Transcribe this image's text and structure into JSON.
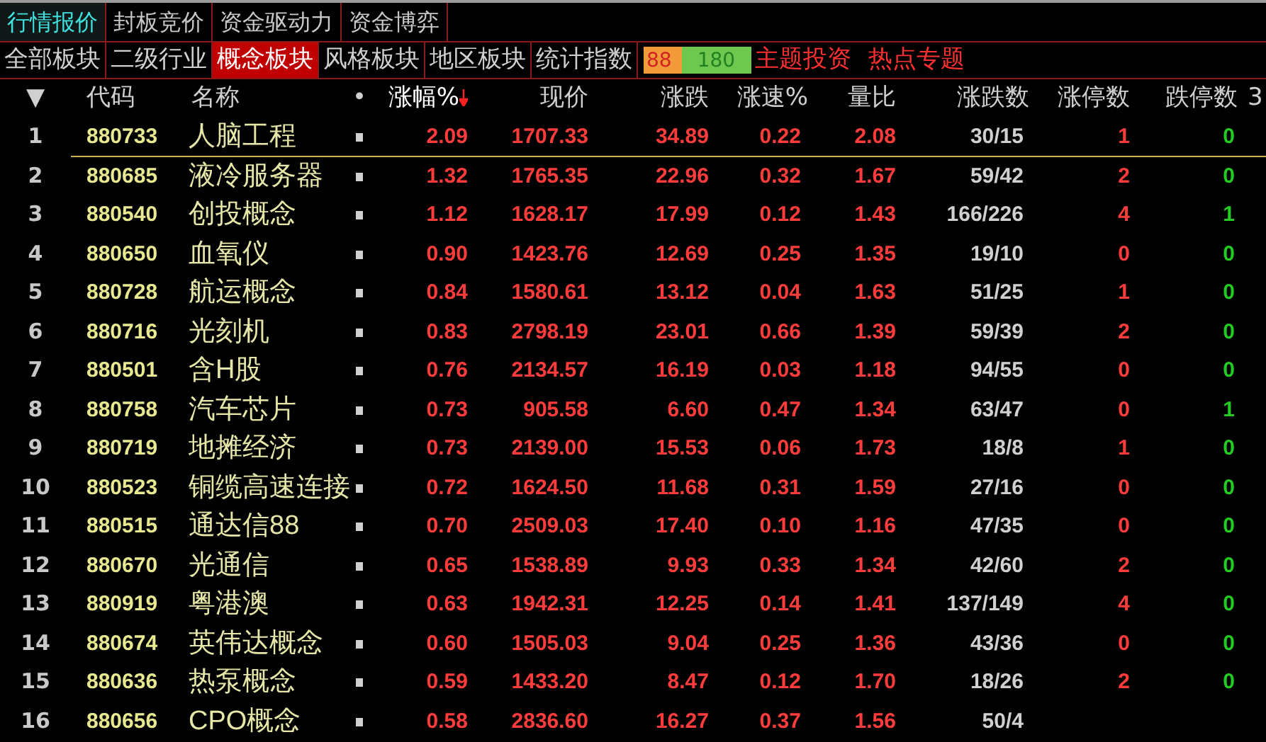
{
  "top_tabs": [
    {
      "label": "行情报价",
      "selected": true
    },
    {
      "label": "封板竞价",
      "selected": false
    },
    {
      "label": "资金驱动力",
      "selected": false
    },
    {
      "label": "资金博弈",
      "selected": false
    }
  ],
  "board_tabs": [
    {
      "label": "全部板块",
      "selected": false
    },
    {
      "label": "二级行业",
      "selected": false
    },
    {
      "label": "概念板块",
      "selected": true
    },
    {
      "label": "风格板块",
      "selected": false
    },
    {
      "label": "地区板块",
      "selected": false
    },
    {
      "label": "统计指数",
      "selected": false
    }
  ],
  "breadth_bar": {
    "up": "88",
    "down": "180",
    "level": 0.35
  },
  "topic_links": [
    "主题投资",
    "热点专题"
  ],
  "table": {
    "columns": [
      {
        "label": "▼",
        "sorted": false
      },
      {
        "label": "代码",
        "sorted": false
      },
      {
        "label": "名称",
        "sorted": false
      },
      {
        "label": "•",
        "sorted": false
      },
      {
        "label": "涨幅%",
        "sorted": true
      },
      {
        "label": "现价",
        "sorted": false
      },
      {
        "label": "涨跌",
        "sorted": false
      },
      {
        "label": "涨速%",
        "sorted": false
      },
      {
        "label": "量比",
        "sorted": false
      },
      {
        "label": "涨跌数",
        "sorted": false
      },
      {
        "label": "涨停数",
        "sorted": false
      },
      {
        "label": "跌停数",
        "sorted": false
      },
      {
        "label": "3",
        "sorted": false
      }
    ],
    "rows": [
      {
        "index": "1",
        "code": "880733",
        "name": "人脑工程",
        "change_pct": "2.09",
        "price": "1707.33",
        "change": "34.89",
        "speed": "0.22",
        "volume_ratio": "2.08",
        "up_down": "30/15",
        "limit_up": "1",
        "limit_down": "0",
        "selected": true
      },
      {
        "index": "2",
        "code": "880685",
        "name": "液冷服务器",
        "change_pct": "1.32",
        "price": "1765.35",
        "change": "22.96",
        "speed": "0.32",
        "volume_ratio": "1.67",
        "up_down": "59/42",
        "limit_up": "2",
        "limit_down": "0",
        "selected": false
      },
      {
        "index": "3",
        "code": "880540",
        "name": "创投概念",
        "change_pct": "1.12",
        "price": "1628.17",
        "change": "17.99",
        "speed": "0.12",
        "volume_ratio": "1.43",
        "up_down": "166/226",
        "limit_up": "4",
        "limit_down": "1",
        "selected": false
      },
      {
        "index": "4",
        "code": "880650",
        "name": "血氧仪",
        "change_pct": "0.90",
        "price": "1423.76",
        "change": "12.69",
        "speed": "0.25",
        "volume_ratio": "1.35",
        "up_down": "19/10",
        "limit_up": "0",
        "limit_down": "0",
        "selected": false
      },
      {
        "index": "5",
        "code": "880728",
        "name": "航运概念",
        "change_pct": "0.84",
        "price": "1580.61",
        "change": "13.12",
        "speed": "0.04",
        "volume_ratio": "1.63",
        "up_down": "51/25",
        "limit_up": "1",
        "limit_down": "0",
        "selected": false
      },
      {
        "index": "6",
        "code": "880716",
        "name": "光刻机",
        "change_pct": "0.83",
        "price": "2798.19",
        "change": "23.01",
        "speed": "0.66",
        "volume_ratio": "1.39",
        "up_down": "59/39",
        "limit_up": "2",
        "limit_down": "0",
        "selected": false
      },
      {
        "index": "7",
        "code": "880501",
        "name": "含H股",
        "change_pct": "0.76",
        "price": "2134.57",
        "change": "16.19",
        "speed": "0.03",
        "volume_ratio": "1.18",
        "up_down": "94/55",
        "limit_up": "0",
        "limit_down": "0",
        "selected": false
      },
      {
        "index": "8",
        "code": "880758",
        "name": "汽车芯片",
        "change_pct": "0.73",
        "price": "905.58",
        "change": "6.60",
        "speed": "0.47",
        "volume_ratio": "1.34",
        "up_down": "63/47",
        "limit_up": "0",
        "limit_down": "1",
        "selected": false
      },
      {
        "index": "9",
        "code": "880719",
        "name": "地摊经济",
        "change_pct": "0.73",
        "price": "2139.00",
        "change": "15.53",
        "speed": "0.06",
        "volume_ratio": "1.73",
        "up_down": "18/8",
        "limit_up": "1",
        "limit_down": "0",
        "selected": false
      },
      {
        "index": "10",
        "code": "880523",
        "name": "铜缆高速连接",
        "change_pct": "0.72",
        "price": "1624.50",
        "change": "11.68",
        "speed": "0.31",
        "volume_ratio": "1.59",
        "up_down": "27/16",
        "limit_up": "0",
        "limit_down": "0",
        "selected": false
      },
      {
        "index": "11",
        "code": "880515",
        "name": "通达信88",
        "change_pct": "0.70",
        "price": "2509.03",
        "change": "17.40",
        "speed": "0.10",
        "volume_ratio": "1.16",
        "up_down": "47/35",
        "limit_up": "0",
        "limit_down": "0",
        "selected": false
      },
      {
        "index": "12",
        "code": "880670",
        "name": "光通信",
        "change_pct": "0.65",
        "price": "1538.89",
        "change": "9.93",
        "speed": "0.33",
        "volume_ratio": "1.34",
        "up_down": "42/60",
        "limit_up": "2",
        "limit_down": "0",
        "selected": false
      },
      {
        "index": "13",
        "code": "880919",
        "name": "粤港澳",
        "change_pct": "0.63",
        "price": "1942.31",
        "change": "12.25",
        "speed": "0.14",
        "volume_ratio": "1.41",
        "up_down": "137/149",
        "limit_up": "4",
        "limit_down": "0",
        "selected": false
      },
      {
        "index": "14",
        "code": "880674",
        "name": "英伟达概念",
        "change_pct": "0.60",
        "price": "1505.03",
        "change": "9.04",
        "speed": "0.25",
        "volume_ratio": "1.36",
        "up_down": "43/36",
        "limit_up": "0",
        "limit_down": "0",
        "selected": false
      },
      {
        "index": "15",
        "code": "880636",
        "name": "热泵概念",
        "change_pct": "0.59",
        "price": "1433.20",
        "change": "8.47",
        "speed": "0.12",
        "volume_ratio": "1.70",
        "up_down": "18/26",
        "limit_up": "2",
        "limit_down": "0",
        "selected": false
      },
      {
        "index": "16",
        "code": "880656",
        "name": "CPO概念",
        "change_pct": "0.58",
        "price": "2836.60",
        "change": "16.27",
        "speed": "0.37",
        "volume_ratio": "1.56",
        "up_down": "50/4",
        "selected": false
      }
    ]
  }
}
